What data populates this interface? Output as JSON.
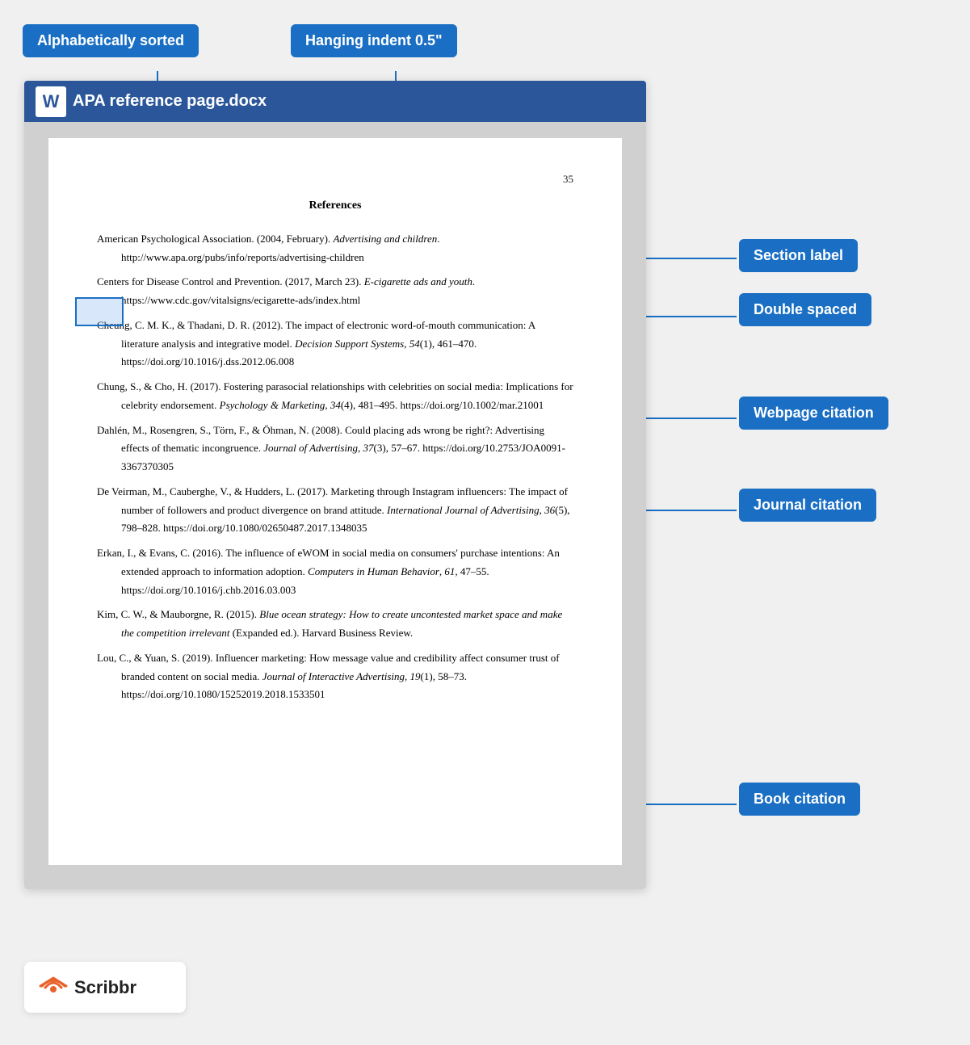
{
  "labels": {
    "alphabetically_sorted": "Alphabetically sorted",
    "hanging_indent": "Hanging indent 0.5\"",
    "section_label": "Section label",
    "double_spaced": "Double spaced",
    "webpage_citation": "Webpage citation",
    "journal_citation": "Journal citation",
    "book_citation": "Book citation"
  },
  "word": {
    "title": "APA reference page.docx",
    "icon": "W"
  },
  "page": {
    "number": "35",
    "heading": "References",
    "entries": [
      {
        "id": "apa2004",
        "text_parts": [
          {
            "type": "normal",
            "text": "American Psychological Association. (2004, February). "
          },
          {
            "type": "italic",
            "text": "Advertising and children"
          },
          {
            "type": "normal",
            "text": ". http://www.apa.org/pubs/info/reports/advertising-children"
          }
        ]
      },
      {
        "id": "cdc2017",
        "text_parts": [
          {
            "type": "normal",
            "text": "Centers for Disease Control and Prevention. (2017, March 23). "
          },
          {
            "type": "italic",
            "text": "E-cigarette ads and youth"
          },
          {
            "type": "normal",
            "text": ". https://www.cdc.gov/vitalsigns/ecigarette-ads/index.html"
          }
        ]
      },
      {
        "id": "cheung2012",
        "text_parts": [
          {
            "type": "normal",
            "text": "Cheung, C. M. K., & Thadani, D. R. (2012). The impact of electronic word-of-mouth communication: A literature analysis and integrative model. "
          },
          {
            "type": "italic",
            "text": "Decision Support Systems"
          },
          {
            "type": "normal",
            "text": ", "
          },
          {
            "type": "italic",
            "text": "54"
          },
          {
            "type": "normal",
            "text": "(1), 461–470. https://doi.org/10.1016/j.dss.2012.06.008"
          }
        ]
      },
      {
        "id": "chung2017",
        "text_parts": [
          {
            "type": "normal",
            "text": "Chung, S., & Cho, H. (2017). Fostering parasocial relationships with celebrities on social media: Implications for celebrity endorsement. "
          },
          {
            "type": "italic",
            "text": "Psychology & Marketing"
          },
          {
            "type": "normal",
            "text": ", "
          },
          {
            "type": "italic",
            "text": "34"
          },
          {
            "type": "normal",
            "text": "(4), 481–495. https://doi.org/10.1002/mar.21001"
          }
        ]
      },
      {
        "id": "dahlen2008",
        "text_parts": [
          {
            "type": "normal",
            "text": "Dahlén, M., Rosengren, S., Törn, F., & Öhman, N. (2008). Could placing ads wrong be right?: Advertising effects of thematic incongruence. "
          },
          {
            "type": "italic",
            "text": "Journal of Advertising"
          },
          {
            "type": "normal",
            "text": ", "
          },
          {
            "type": "italic",
            "text": "37"
          },
          {
            "type": "normal",
            "text": "(3), 57–67. https://doi.org/10.2753/JOA0091-3367370305"
          }
        ]
      },
      {
        "id": "deveirman2017",
        "text_parts": [
          {
            "type": "normal",
            "text": "De Veirman, M., Cauberghe, V., & Hudders, L. (2017). Marketing through Instagram influencers: The impact of number of followers and product divergence on brand attitude. "
          },
          {
            "type": "italic",
            "text": "International Journal of Advertising"
          },
          {
            "type": "normal",
            "text": ", "
          },
          {
            "type": "italic",
            "text": "36"
          },
          {
            "type": "normal",
            "text": "(5), 798–828. https://doi.org/10.1080/02650487.2017.1348035"
          }
        ]
      },
      {
        "id": "erkan2016",
        "text_parts": [
          {
            "type": "normal",
            "text": "Erkan, I., & Evans, C. (2016). The influence of eWOM in social media on consumers' purchase intentions: An extended approach to information adoption. "
          },
          {
            "type": "italic",
            "text": "Computers in Human Behavior"
          },
          {
            "type": "normal",
            "text": ", "
          },
          {
            "type": "italic",
            "text": "61"
          },
          {
            "type": "normal",
            "text": ", 47–55. https://doi.org/10.1016/j.chb.2016.03.003"
          }
        ]
      },
      {
        "id": "kim2015",
        "text_parts": [
          {
            "type": "normal",
            "text": "Kim, C. W., & Mauborgne, R. (2015). "
          },
          {
            "type": "italic",
            "text": "Blue ocean strategy: How to create uncontested market space and make the competition irrelevant"
          },
          {
            "type": "normal",
            "text": " (Expanded ed.). Harvard Business Review."
          }
        ]
      },
      {
        "id": "lou2019",
        "text_parts": [
          {
            "type": "normal",
            "text": "Lou, C., & Yuan, S. (2019). Influencer marketing: How message value and credibility affect consumer trust of branded content on social media. "
          },
          {
            "type": "italic",
            "text": "Journal of Interactive Advertising"
          },
          {
            "type": "normal",
            "text": ", "
          },
          {
            "type": "italic",
            "text": "19"
          },
          {
            "type": "normal",
            "text": "(1), 58–73. https://doi.org/10.1080/15252019.2018.1533501"
          }
        ]
      }
    ]
  },
  "scribbr": {
    "name": "Scribbr"
  },
  "colors": {
    "blue": "#1a6fc4",
    "word_blue": "#2b579a"
  }
}
